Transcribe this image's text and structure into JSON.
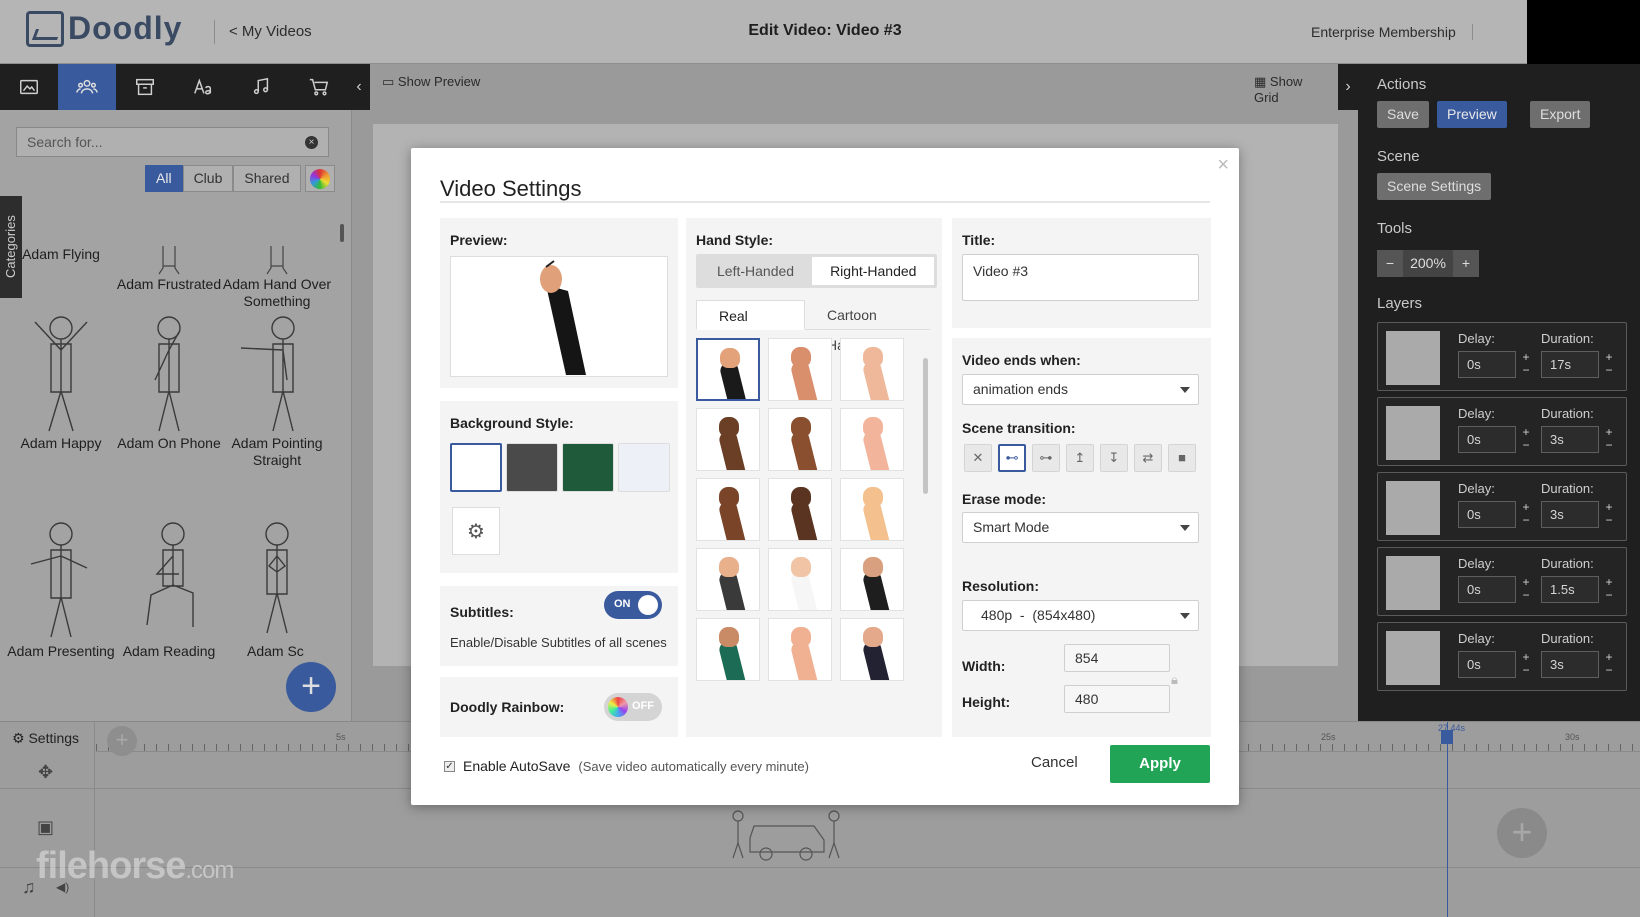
{
  "app": {
    "logo_text": "Doodly",
    "back_link": "< My Videos",
    "page_title": "Edit Video: Video #3",
    "membership": "Enterprise Membership"
  },
  "toolbar": {
    "tabs": [
      {
        "icon": "image-icon",
        "active": false
      },
      {
        "icon": "characters-icon",
        "active": true
      },
      {
        "icon": "props-icon",
        "active": false
      },
      {
        "icon": "text-icon",
        "active": false
      },
      {
        "icon": "music-icon",
        "active": false
      },
      {
        "icon": "cart-icon",
        "active": false
      }
    ]
  },
  "library": {
    "search_placeholder": "Search for...",
    "filters": [
      "All",
      "Club",
      "Shared"
    ],
    "active_filter": "All",
    "categories_tab": "Categories",
    "assets": [
      "Adam Flying",
      "Adam Frustrated",
      "Adam Hand Over Something",
      "Adam Happy",
      "Adam On Phone",
      "Adam Pointing Straight",
      "Adam Presenting",
      "Adam Reading",
      "Adam Sc"
    ]
  },
  "canvas": {
    "show_preview": "Show Preview",
    "show_grid": "Show Grid"
  },
  "right_panel": {
    "actions_title": "Actions",
    "save": "Save",
    "preview": "Preview",
    "export": "Export",
    "scene_title": "Scene",
    "scene_settings": "Scene Settings",
    "tools_title": "Tools",
    "zoom": "200%",
    "layers_title": "Layers",
    "delay_label": "Delay:",
    "duration_label": "Duration:",
    "layers": [
      {
        "delay": "0s",
        "duration": "17s"
      },
      {
        "delay": "0s",
        "duration": "3s"
      },
      {
        "delay": "0s",
        "duration": "3s"
      },
      {
        "delay": "0s",
        "duration": "1.5s"
      },
      {
        "delay": "0s",
        "duration": "3s"
      }
    ]
  },
  "timeline": {
    "settings": "Settings",
    "ticks": [
      "5s",
      "25s",
      "30s"
    ],
    "playhead": "27.44s",
    "watermark": "filehorse",
    "watermark_suffix": ".com"
  },
  "modal": {
    "title": "Video Settings",
    "close": "×",
    "preview_label": "Preview:",
    "background_label": "Background Style:",
    "background_swatches": [
      "#ffffff",
      "#4a4a4a",
      "#1f5a3a",
      "#eef0f8"
    ],
    "subtitles_label": "Subtitles:",
    "subtitles_toggle": "ON",
    "subtitles_hint": "Enable/Disable Subtitles of all scenes",
    "rainbow_label": "Doodly Rainbow:",
    "rainbow_toggle": "OFF",
    "hand_style_label": "Hand Style:",
    "handed": [
      "Left-Handed",
      "Right-Handed"
    ],
    "handed_active": "Right-Handed",
    "hand_tabs": [
      "Real Hands",
      "Cartoon Hands"
    ],
    "hand_tab_active": "Real Hands",
    "hands": [
      {
        "skin": "#e3a27a",
        "sleeve": "#1a1a1a"
      },
      {
        "skin": "#d98e6c",
        "sleeve": "#d98e6c"
      },
      {
        "skin": "#f0b89a",
        "sleeve": "#f0b89a"
      },
      {
        "skin": "#6b3f26",
        "sleeve": "#6b3f26"
      },
      {
        "skin": "#8a4f2e",
        "sleeve": "#8a4f2e"
      },
      {
        "skin": "#f2b49a",
        "sleeve": "#f2b49a"
      },
      {
        "skin": "#7a4428",
        "sleeve": "#7a4428"
      },
      {
        "skin": "#5a3420",
        "sleeve": "#5a3420"
      },
      {
        "skin": "#f4c08e",
        "sleeve": "#f4c08e"
      },
      {
        "skin": "#e9b08c",
        "sleeve": "#3a3a3a"
      },
      {
        "skin": "#f2c4a6",
        "sleeve": "#f6f6f6"
      },
      {
        "skin": "#d9a080",
        "sleeve": "#1e1e1e"
      },
      {
        "skin": "#c98a66",
        "sleeve": "#1b6b55"
      },
      {
        "skin": "#f0b092",
        "sleeve": "#f0b092"
      },
      {
        "skin": "#e4a88a",
        "sleeve": "#222233"
      }
    ],
    "title_label": "Title:",
    "title_value": "Video #3",
    "video_ends_label": "Video ends when:",
    "video_ends_value": "animation ends",
    "scene_transition_label": "Scene transition:",
    "transitions": [
      "none-icon",
      "slide-right-icon",
      "slide-left-icon",
      "slide-up-icon",
      "slide-down-icon",
      "swap-icon",
      "camera-icon"
    ],
    "transition_active": 1,
    "erase_label": "Erase mode:",
    "erase_value": "Smart Mode",
    "resolution_label": "Resolution:",
    "resolution_value": "480p  -  (854x480)",
    "width_label": "Width:",
    "width_value": "854",
    "height_label": "Height:",
    "height_value": "480",
    "autosave_label": "Enable AutoSave",
    "autosave_hint": "(Save video automatically every minute)",
    "cancel": "Cancel",
    "apply": "Apply"
  }
}
